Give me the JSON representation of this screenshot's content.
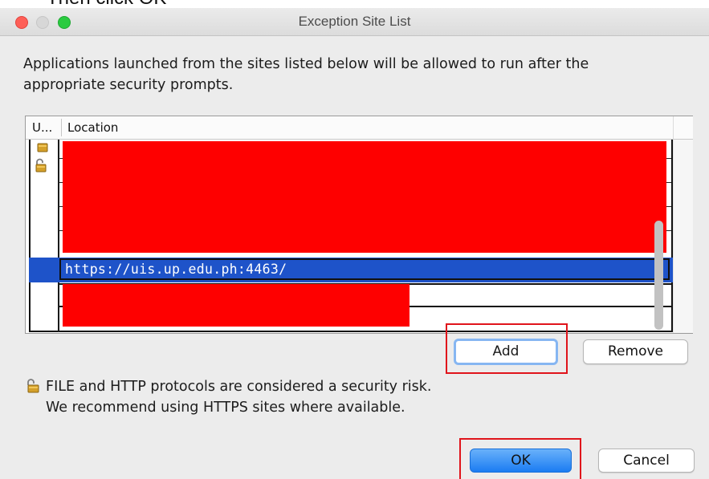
{
  "window": {
    "title": "Exception Site List"
  },
  "intro": "Applications launched from the sites listed below will be allowed to run after the appropriate security prompts.",
  "table": {
    "columns": [
      "U...",
      "Location"
    ],
    "selected_row": {
      "location": "https://uis.up.edu.ph:4463/"
    }
  },
  "buttons": {
    "add": "Add",
    "remove": "Remove",
    "ok": "OK",
    "cancel": "Cancel"
  },
  "warning": {
    "line1": "FILE and HTTP protocols are considered a security risk.",
    "line2": "We recommend using HTTPS sites where available."
  },
  "colors": {
    "accent": "#1e53c9",
    "highlight": "#e0141b",
    "redaction": "#fe0000"
  },
  "icons": [
    "unlocked-padlock-icon"
  ]
}
